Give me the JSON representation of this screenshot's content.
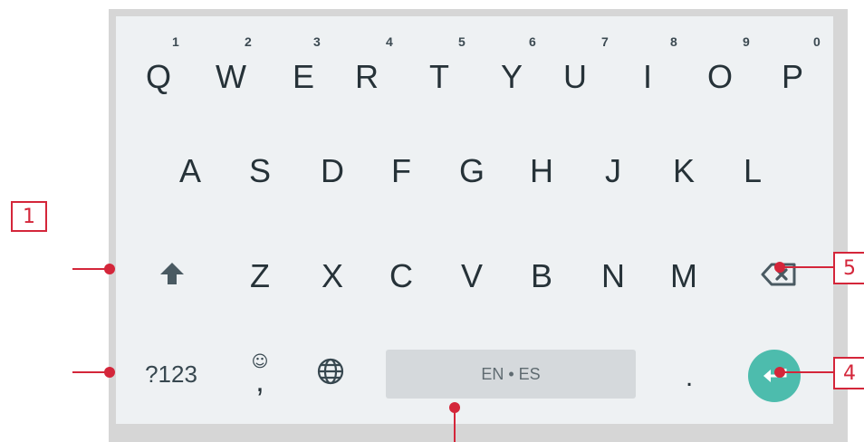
{
  "keyboard": {
    "row1": [
      {
        "label": "Q",
        "hint": "1"
      },
      {
        "label": "W",
        "hint": "2"
      },
      {
        "label": "E",
        "hint": "3"
      },
      {
        "label": "R",
        "hint": "4"
      },
      {
        "label": "T",
        "hint": "5"
      },
      {
        "label": "Y",
        "hint": "6"
      },
      {
        "label": "U",
        "hint": "7"
      },
      {
        "label": "I",
        "hint": "8"
      },
      {
        "label": "O",
        "hint": "9"
      },
      {
        "label": "P",
        "hint": "0"
      }
    ],
    "row2": [
      "A",
      "S",
      "D",
      "F",
      "G",
      "H",
      "J",
      "K",
      "L"
    ],
    "row3": [
      "Z",
      "X",
      "C",
      "V",
      "B",
      "N",
      "M"
    ],
    "bottom": {
      "symbols_label": "?123",
      "comma_label": ",",
      "emoji_hint": "☺",
      "space_label": "EN • ES",
      "period_label": "."
    },
    "icons": {
      "shift": "shift-arrow-icon",
      "backspace": "backspace-icon",
      "globe": "globe-icon",
      "enter": "enter-arrow-icon"
    },
    "colors": {
      "keyboard_bg": "#eef1f3",
      "key_text": "#263238",
      "space_bar": "#d5d9dc",
      "enter_button": "#4dbcad",
      "annotation": "#d4263a"
    }
  },
  "annotations": {
    "label_1": "1",
    "label_4": "4",
    "label_5": "5"
  }
}
